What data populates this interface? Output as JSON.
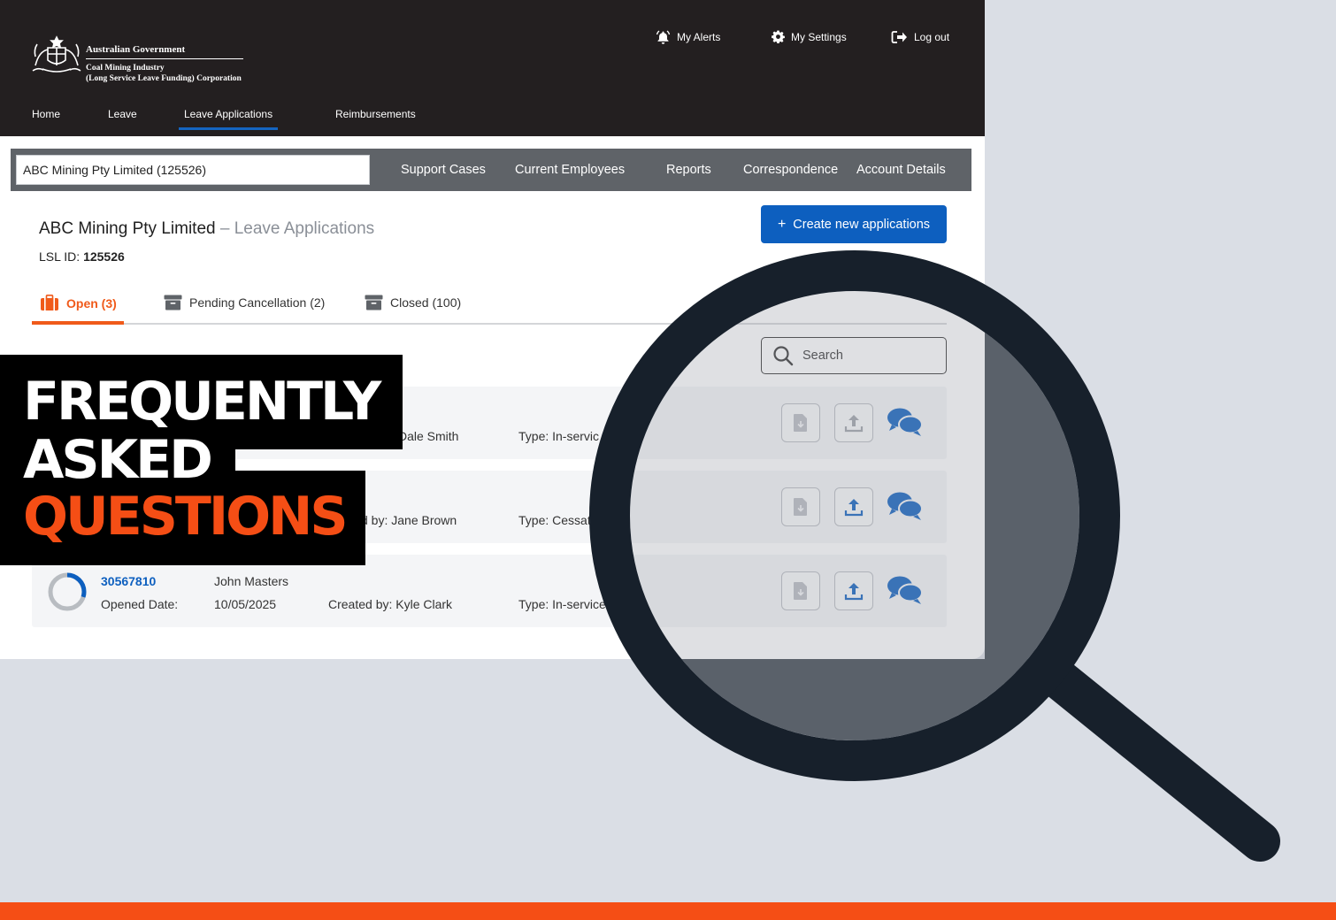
{
  "brand": {
    "government": "Australian Government",
    "corp_line1": "Coal Mining Industry",
    "corp_line2": "(Long Service Leave Funding) Corporation"
  },
  "utility_nav": [
    {
      "label": "My Alerts",
      "icon": "bell-icon"
    },
    {
      "label": "My Settings",
      "icon": "gear-icon"
    },
    {
      "label": "Log out",
      "icon": "logout-icon"
    }
  ],
  "main_nav": [
    {
      "label": "Home"
    },
    {
      "label": "Leave"
    },
    {
      "label": "Leave Applications",
      "active": true
    },
    {
      "label": "Reimbursements"
    }
  ],
  "account_selector": {
    "value": "ABC Mining Pty Limited (125526)"
  },
  "sub_nav": [
    {
      "label": "Support Cases"
    },
    {
      "label": "Current Employees"
    },
    {
      "label": "Reports"
    },
    {
      "label": "Correspondence"
    },
    {
      "label": "Account Details"
    }
  ],
  "page": {
    "title": "ABC Mining Pty Limited",
    "subtitle": "– Leave Applications",
    "lsl_label": "LSL ID:",
    "lsl_value": "125526",
    "create_button": "Create new applications"
  },
  "tabs": [
    {
      "label": "Open (3)",
      "active": true
    },
    {
      "label": "Pending Cancellation (2)"
    },
    {
      "label": "Closed (100)"
    }
  ],
  "search": {
    "placeholder": "Search"
  },
  "applications": [
    {
      "id": "",
      "name": "",
      "opened_label": "",
      "opened_date": "",
      "created_by": "Dale Smith",
      "type": "Type: In-servic"
    },
    {
      "id": "",
      "name": "",
      "opened_label": "",
      "opened_date": "",
      "created_by": "d by: Jane Brown",
      "type": "Type: Cessat"
    },
    {
      "id": "30567810",
      "name": "John Masters",
      "opened_label": "Opened Date:",
      "opened_date": "10/05/2025",
      "created_by": "Created by: Kyle Clark",
      "type": "Type: In-service",
      "progress": 0.3
    }
  ],
  "overlay": {
    "line1": "FREQUENTLY",
    "line2": "ASKED",
    "line3": "QUESTIONS"
  },
  "colors": {
    "accent_orange": "#f05a1a",
    "primary_blue": "#0d5fbf",
    "header_dark": "#231f20",
    "magnifier": "#17202b"
  }
}
